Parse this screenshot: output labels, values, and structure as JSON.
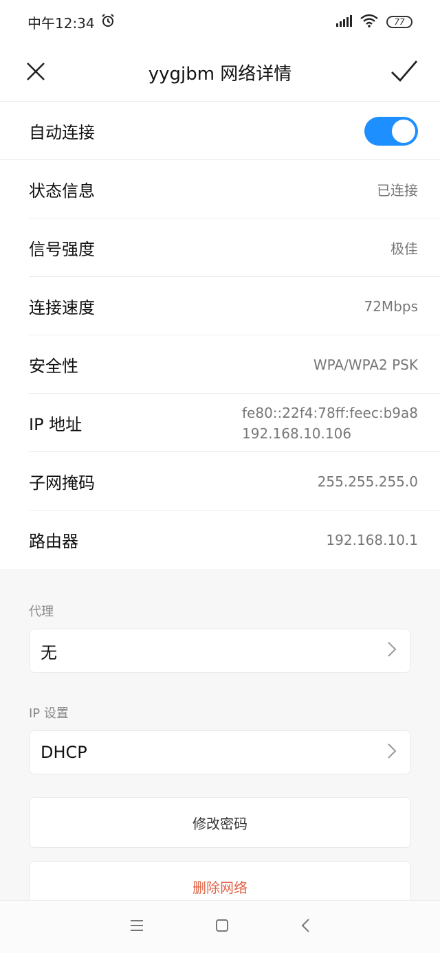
{
  "status_bar": {
    "time": "中午12:34",
    "battery": "77"
  },
  "header": {
    "title": "yygjbm  网络详情"
  },
  "rows": {
    "auto_connect": {
      "label": "自动连接",
      "enabled": true
    },
    "status": {
      "label": "状态信息",
      "value": "已连接"
    },
    "signal": {
      "label": "信号强度",
      "value": "极佳"
    },
    "speed": {
      "label": "连接速度",
      "value": "72Mbps"
    },
    "security": {
      "label": "安全性",
      "value": "WPA/WPA2 PSK"
    },
    "ip": {
      "label": "IP 地址",
      "value_line1": "fe80::22f4:78ff:feec:b9a8",
      "value_line2": "192.168.10.106"
    },
    "subnet": {
      "label": "子网掩码",
      "value": "255.255.255.0"
    },
    "router": {
      "label": "路由器",
      "value": "192.168.10.1"
    }
  },
  "proxy": {
    "section_label": "代理",
    "value": "无"
  },
  "ip_settings": {
    "section_label": "IP 设置",
    "value": "DHCP"
  },
  "actions": {
    "change_password": "修改密码",
    "delete_network": "删除网络"
  },
  "colors": {
    "accent": "#1e8fff",
    "danger": "#e0654a"
  },
  "icons": {
    "close": "close-icon",
    "confirm": "checkmark-icon",
    "alarm": "alarm-icon",
    "signal": "signal-icon",
    "wifi": "wifi-icon",
    "chevron": "chevron-right-icon",
    "nav_menu": "menu-icon",
    "nav_home": "home-icon",
    "nav_back": "back-icon"
  }
}
